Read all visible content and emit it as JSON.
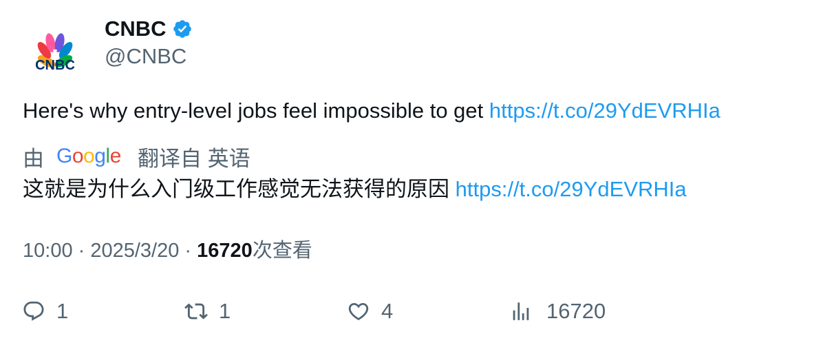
{
  "author": {
    "display_name": "CNBC",
    "handle": "@CNBC",
    "verified": true,
    "avatar_text": "CNBC",
    "avatar_icon": "cnbc-peacock-logo"
  },
  "tweet": {
    "text": "Here's why entry-level jobs feel impossible to get ",
    "link": "https://t.co/29YdEVRHIa"
  },
  "translation": {
    "prefix": "由",
    "provider": "Google",
    "suffix": "翻译自 英语",
    "text": "这就是为什么入门级工作感觉无法获得的原因 ",
    "link": "https://t.co/29YdEVRHIa"
  },
  "meta": {
    "time": "10:00",
    "separator": " · ",
    "date": "2025/3/20",
    "views_count": "16720",
    "views_label": "次查看"
  },
  "actions": {
    "reply": {
      "icon": "reply-icon",
      "count": "1"
    },
    "retweet": {
      "icon": "retweet-icon",
      "count": "1"
    },
    "like": {
      "icon": "heart-icon",
      "count": "4"
    },
    "views": {
      "icon": "views-icon",
      "count": "16720"
    }
  },
  "colors": {
    "text": "#0f1419",
    "secondary": "#536471",
    "link": "#1d9bf0",
    "verified": "#1d9bf0"
  }
}
